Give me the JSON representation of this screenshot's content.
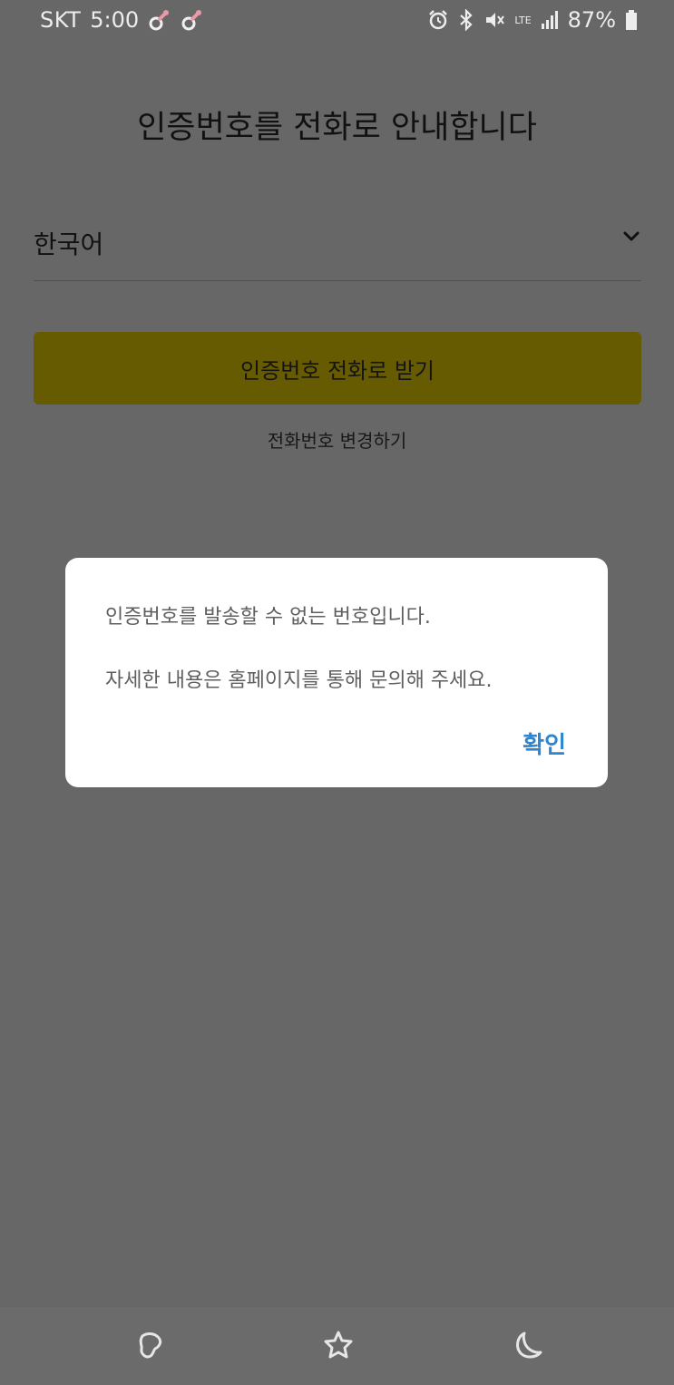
{
  "status_bar": {
    "carrier": "SKT",
    "time": "5:00",
    "battery": "87%",
    "network": "LTE",
    "icons_left": [
      "pacifier-icon",
      "pacifier-icon"
    ],
    "icons_right": [
      "alarm-icon",
      "bluetooth-icon",
      "mute-icon",
      "lte-icon",
      "signal-icon",
      "battery-icon"
    ]
  },
  "page": {
    "title": "인증번호를 전화로 안내합니다",
    "language_select": {
      "value": "한국어"
    },
    "primary_button": "인증번호 전화로 받기",
    "change_phone_link": "전화번호 변경하기"
  },
  "dialog": {
    "message1": "인증번호를 발송할 수 없는 번호입니다.",
    "message2": "자세한 내용은 홈페이지를 통해 문의해 주세요.",
    "confirm_label": "확인"
  },
  "nav_bar": {
    "icons": [
      "recent-apps-icon",
      "home-icon",
      "back-icon"
    ]
  },
  "colors": {
    "overlay_background": "#676767",
    "primary_button": "#665b00",
    "dialog_accent": "#2e86d0"
  }
}
